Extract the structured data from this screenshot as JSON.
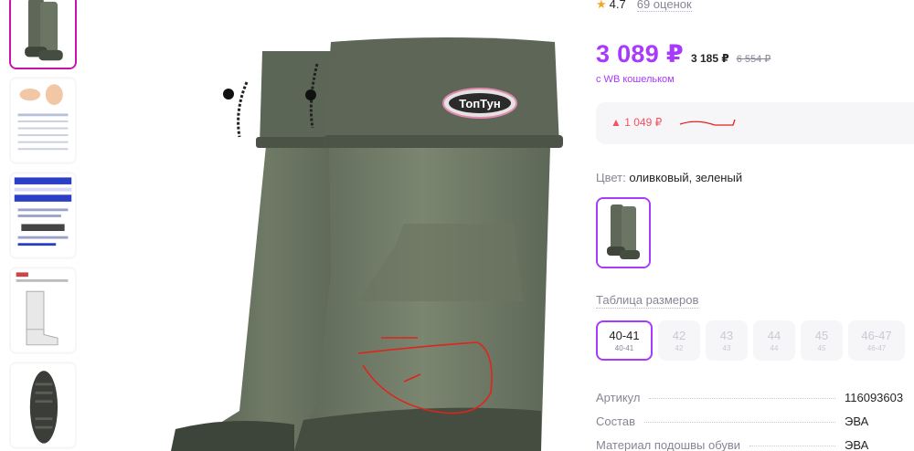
{
  "thumbnails": [
    {
      "name": "boots-photo",
      "active": true
    },
    {
      "name": "foot-size-guide"
    },
    {
      "name": "brand-info-card"
    },
    {
      "name": "insert-liner"
    },
    {
      "name": "sole-tread"
    }
  ],
  "main_image": {
    "brand_label": "ТопТун"
  },
  "rating": {
    "value": "4.7",
    "reviews": "69 оценок"
  },
  "price": {
    "main": "3 089 ₽",
    "wallet": "3 185 ₽",
    "old": "6 554 ₽",
    "wallet_note": "с WB кошельком"
  },
  "price_change": {
    "text": "▲ 1 049 ₽"
  },
  "color": {
    "label": "Цвет:",
    "value": "оливковый, зеленый"
  },
  "size_table_link": "Таблица размеров",
  "sizes": [
    {
      "main": "40-41",
      "sub": "40-41",
      "selected": true
    },
    {
      "main": "42",
      "sub": "42"
    },
    {
      "main": "43",
      "sub": "43"
    },
    {
      "main": "44",
      "sub": "44"
    },
    {
      "main": "45",
      "sub": "45"
    },
    {
      "main": "46-47",
      "sub": "46-47"
    }
  ],
  "params": [
    {
      "key": "Артикул",
      "value": "116093603"
    },
    {
      "key": "Состав",
      "value": "ЭВА"
    },
    {
      "key": "Материал подошвы обуви",
      "value": "ЭВА"
    }
  ],
  "colors": {
    "accent": "#a73afd",
    "selected_border": "#cb11ab",
    "price_up": "#f5515f",
    "boot_olive": "#6b7563"
  }
}
